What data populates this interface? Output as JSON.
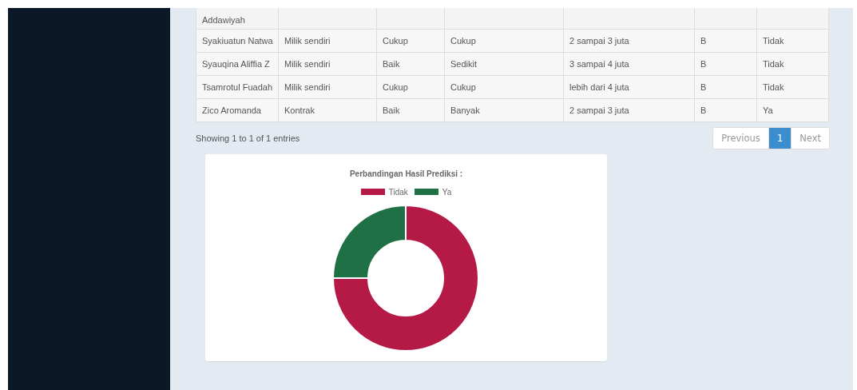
{
  "table": {
    "rows": [
      {
        "cells": [
          "Addawiyah"
        ]
      },
      {
        "cells": [
          "Syakiuatun Natwa",
          "Milik sendiri",
          "Cukup",
          "Cukup",
          "2 sampai 3 juta",
          "B",
          "Tidak"
        ]
      },
      {
        "cells": [
          "Syauqina Aliffia Z",
          "Milik sendiri",
          "Baik",
          "Sedikit",
          "3 sampai 4 juta",
          "B",
          "Tidak"
        ]
      },
      {
        "cells": [
          "Tsamrotul Fuadah",
          "Milik sendiri",
          "Cukup",
          "Cukup",
          "lebih dari 4 juta",
          "B",
          "Tidak"
        ]
      },
      {
        "cells": [
          "Zico Aromanda",
          "Kontrak",
          "Baik",
          "Banyak",
          "2 sampai 3 juta",
          "B",
          "Ya"
        ]
      }
    ]
  },
  "info": "Showing 1 to 1 of 1 entries",
  "pagination": [
    {
      "label": "Previous",
      "selected": false
    },
    {
      "label": "1",
      "selected": true
    },
    {
      "label": "Next",
      "selected": false
    }
  ],
  "chart_data": {
    "type": "donut",
    "title": "Perbandingan Hasil Prediksi :",
    "categories": [
      "Tidak",
      "Ya"
    ],
    "values": [
      75,
      25
    ],
    "colors": [
      "#b51a46",
      "#1f7044"
    ],
    "legend": true
  }
}
